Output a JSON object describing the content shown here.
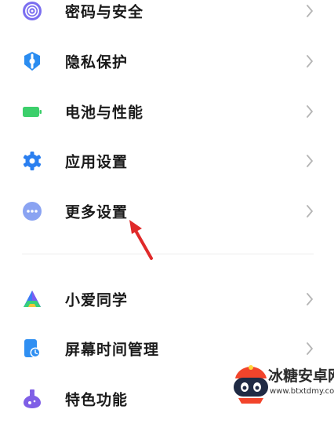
{
  "settings_list": {
    "items": [
      {
        "label": "密码与安全",
        "icon": "fingerprint-icon",
        "icon_color": "#7b6ff0"
      },
      {
        "label": "隐私保护",
        "icon": "privacy-shield-icon",
        "icon_color": "#2a8cf0"
      },
      {
        "label": "电池与性能",
        "icon": "battery-icon",
        "icon_color": "#3ccf6b"
      },
      {
        "label": "应用设置",
        "icon": "gear-icon",
        "icon_color": "#2a7ff0"
      },
      {
        "label": "更多设置",
        "icon": "more-dots-icon",
        "icon_color": "#8aa3f2"
      },
      {
        "label": "小爱同学",
        "icon": "xiaoai-icon",
        "icon_color": "#3b7bf5"
      },
      {
        "label": "屏幕时间管理",
        "icon": "screen-time-icon",
        "icon_color": "#2f8ff2"
      },
      {
        "label": "特色功能",
        "icon": "special-features-icon",
        "icon_color": "#7f5fe6"
      }
    ]
  },
  "annotation": {
    "arrow_color": "#e02a2a"
  },
  "watermark": {
    "name": "冰糖安卓网",
    "url": "www.btxtdmy.com"
  }
}
